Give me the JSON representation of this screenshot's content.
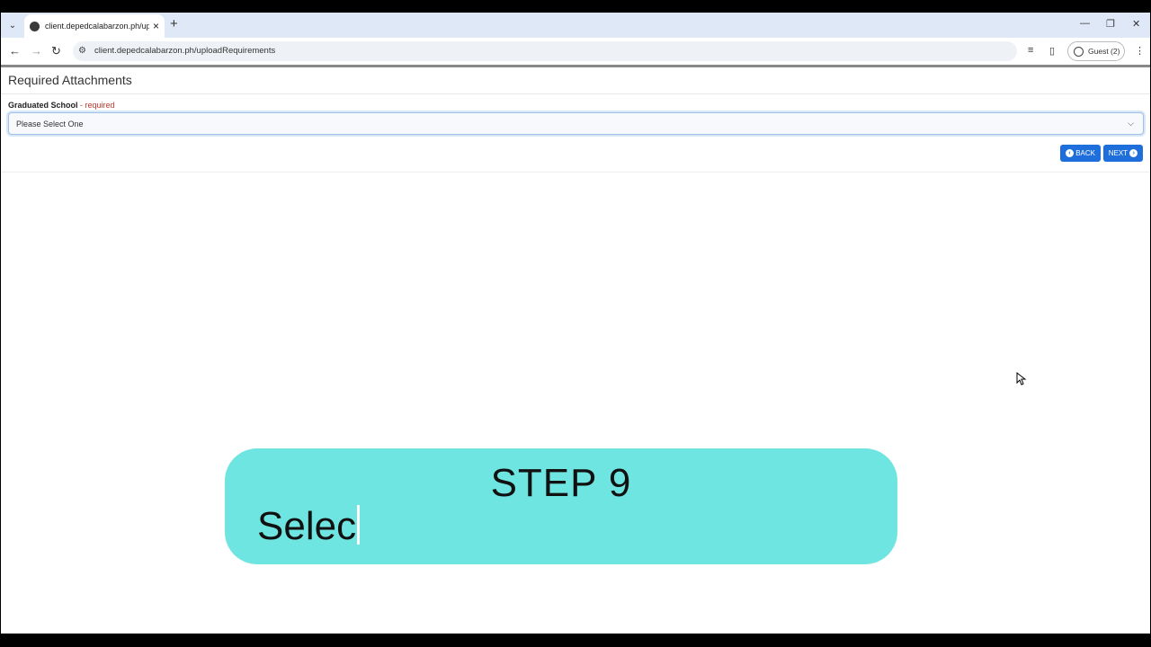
{
  "browser": {
    "tab_title": "client.depedcalabarzon.ph/uplo",
    "url": "client.depedcalabarzon.ph/uploadRequirements",
    "profile_label": "Guest (2)"
  },
  "page": {
    "heading": "Required Attachments",
    "field_label": "Graduated School",
    "field_sep": " - ",
    "field_required": "required",
    "select_value": "Please Select One",
    "back_label": "BACK",
    "next_label": "NEXT"
  },
  "overlay": {
    "step_title": "STEP 9",
    "typing_text": "Selec"
  },
  "colors": {
    "tabstrip": "#dfe8f7",
    "button": "#1e6fdc",
    "required": "#c0392b",
    "banner": "#6ee5e0"
  }
}
